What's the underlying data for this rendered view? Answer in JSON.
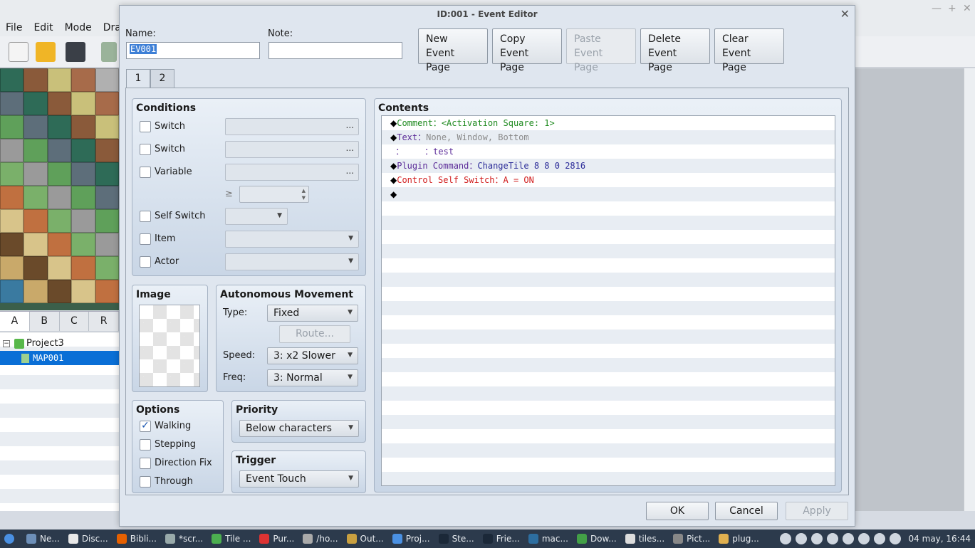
{
  "menubar": {
    "items": [
      "File",
      "Edit",
      "Mode",
      "Draw"
    ]
  },
  "tileset_tabs": [
    "A",
    "B",
    "C",
    "R"
  ],
  "tree": {
    "project": "Project3",
    "map": "MAP001"
  },
  "dialog": {
    "title": "ID:001 - Event Editor",
    "name_label": "Name:",
    "name_value": "EV001",
    "note_label": "Note:",
    "note_value": "",
    "page_buttons": [
      {
        "line1": "New",
        "line2": "Event Page",
        "enabled": true
      },
      {
        "line1": "Copy",
        "line2": "Event Page",
        "enabled": true
      },
      {
        "line1": "Paste",
        "line2": "Event Page",
        "enabled": false
      },
      {
        "line1": "Delete",
        "line2": "Event Page",
        "enabled": true
      },
      {
        "line1": "Clear",
        "line2": "Event Page",
        "enabled": true
      }
    ],
    "tabs": [
      "1",
      "2"
    ],
    "conditions": {
      "title": "Conditions",
      "switch1": "Switch",
      "switch2": "Switch",
      "variable": "Variable",
      "gte": "≥",
      "self_switch": "Self Switch",
      "item": "Item",
      "actor": "Actor",
      "dots": "..."
    },
    "image": {
      "title": "Image"
    },
    "autonomous": {
      "title": "Autonomous Movement",
      "type_label": "Type:",
      "type_value": "Fixed",
      "route_label": "Route...",
      "speed_label": "Speed:",
      "speed_value": "3: x2 Slower",
      "freq_label": "Freq:",
      "freq_value": "3: Normal"
    },
    "options": {
      "title": "Options",
      "walking": "Walking",
      "stepping": "Stepping",
      "direction_fix": "Direction Fix",
      "through": "Through"
    },
    "priority": {
      "title": "Priority",
      "value": "Below characters"
    },
    "trigger": {
      "title": "Trigger",
      "value": "Event Touch"
    },
    "contents": {
      "title": "Contents",
      "commands": [
        {
          "head": "Comment：",
          "body": "<Activation Square: 1>",
          "color": "#1f8a1f",
          "bodycolor": "#1f8a1f",
          "diamond": true
        },
        {
          "head": "Text：",
          "body": "None, Window, Bottom",
          "color": "#5b2b98",
          "bodycolor": "#8a8a8a",
          "diamond": true
        },
        {
          "head": "：    ：",
          "body": "test",
          "color": "#5b2b98",
          "bodycolor": "#5b2b98",
          "diamond": false
        },
        {
          "head": "Plugin Command：",
          "body": "ChangeTile 8 8 0 2816",
          "color": "#5b2b98",
          "bodycolor": "#2b2b98",
          "diamond": true
        },
        {
          "head": "Control Self Switch：",
          "body": "A = ON",
          "color": "#d11d1d",
          "bodycolor": "#d11d1d",
          "diamond": true
        },
        {
          "head": "",
          "body": "",
          "color": "#000",
          "bodycolor": "#000",
          "diamond": true
        }
      ]
    },
    "footer": {
      "ok": "OK",
      "cancel": "Cancel",
      "apply": "Apply"
    }
  },
  "taskbar": {
    "tasks": [
      "Ne...",
      "Disc...",
      "Bibli...",
      "*scr...",
      "Tile ...",
      "Pur...",
      "/ho...",
      "Out...",
      "Proj...",
      "Ste...",
      "Frie...",
      "mac...",
      "Dow...",
      "tiles...",
      "Pict...",
      "plug..."
    ],
    "clock": "04 may, 16:44"
  }
}
